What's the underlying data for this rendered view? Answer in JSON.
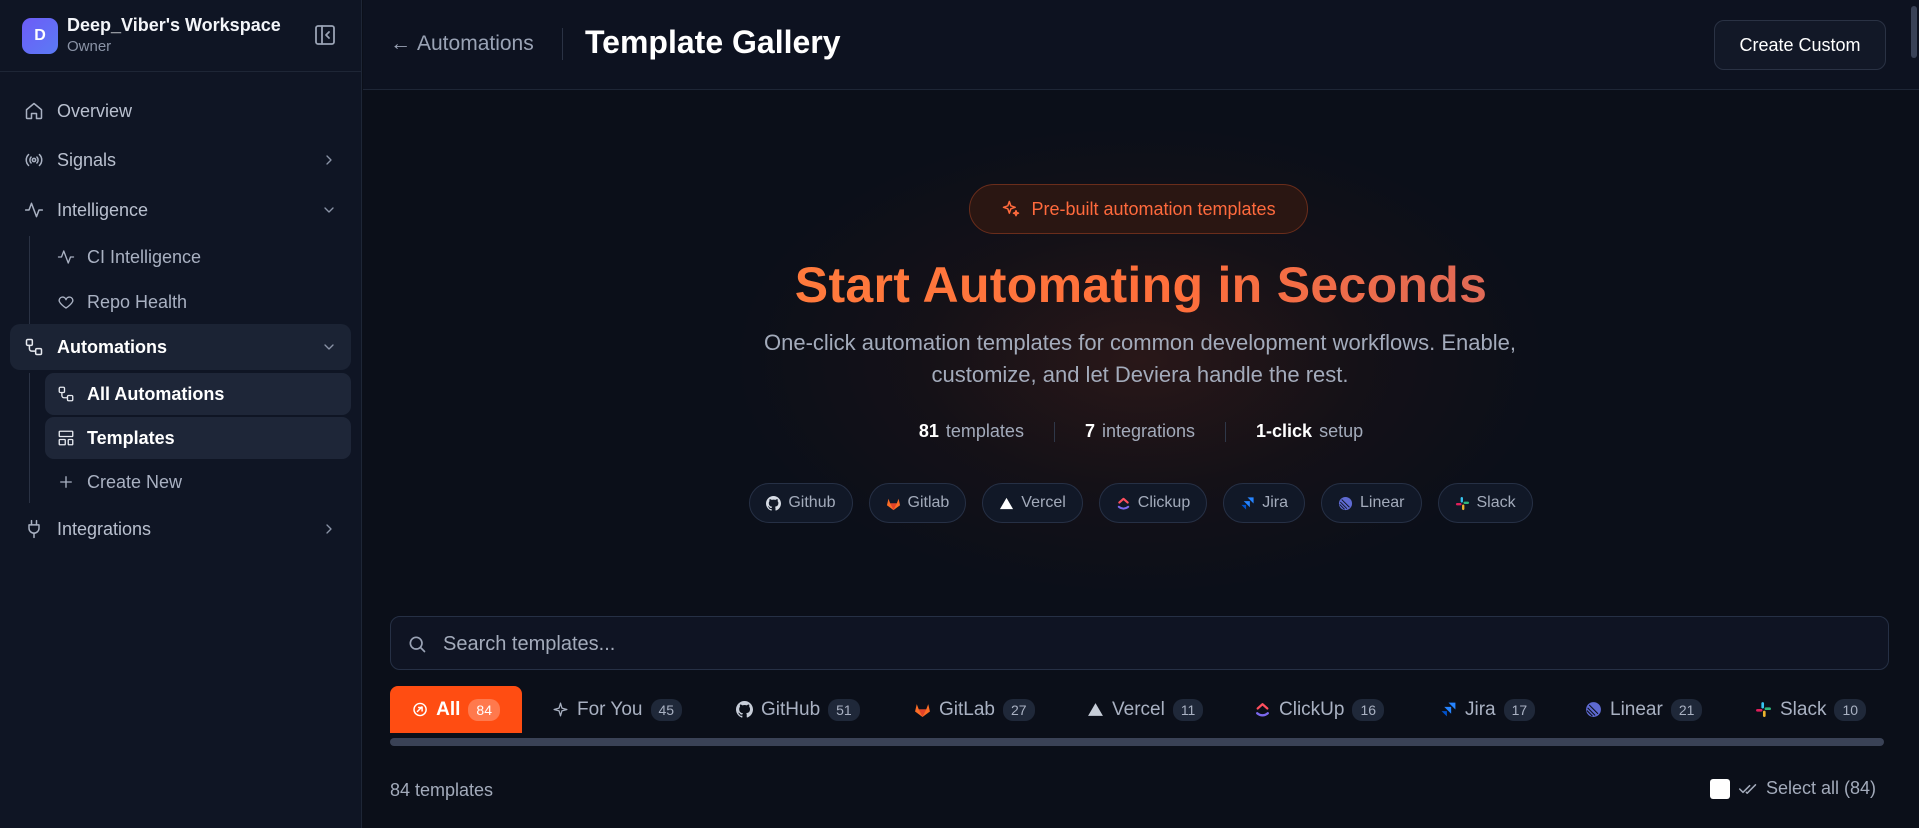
{
  "workspace": {
    "avatar_letter": "D",
    "name": "Deep_Viber's Workspace",
    "role": "Owner"
  },
  "sidebar": {
    "items": [
      {
        "label": "Overview"
      },
      {
        "label": "Signals"
      },
      {
        "label": "Intelligence"
      },
      {
        "label": "Automations"
      },
      {
        "label": "Integrations"
      }
    ],
    "intelligence_sub": [
      {
        "label": "CI Intelligence"
      },
      {
        "label": "Repo Health"
      }
    ],
    "automations_sub": [
      {
        "label": "All Automations"
      },
      {
        "label": "Templates"
      },
      {
        "label": "Create New"
      }
    ]
  },
  "header": {
    "back_label": "Automations",
    "title": "Template Gallery",
    "create_label": "Create Custom"
  },
  "hero": {
    "pill": "Pre-built automation templates",
    "title": "Start Automating in Seconds",
    "subtitle": "One-click automation templates for common development workflows. Enable, customize, and let Deviera handle the rest.",
    "stats": [
      {
        "value": "81",
        "label": "templates"
      },
      {
        "value": "7",
        "label": "integrations"
      },
      {
        "value": "1-click",
        "label": "setup"
      }
    ],
    "integrations": [
      {
        "name": "Github",
        "icon": "github-icon"
      },
      {
        "name": "Gitlab",
        "icon": "gitlab-icon"
      },
      {
        "name": "Vercel",
        "icon": "vercel-icon"
      },
      {
        "name": "Clickup",
        "icon": "clickup-icon"
      },
      {
        "name": "Jira",
        "icon": "jira-icon"
      },
      {
        "name": "Linear",
        "icon": "linear-icon"
      },
      {
        "name": "Slack",
        "icon": "slack-icon"
      }
    ]
  },
  "search": {
    "placeholder": "Search templates..."
  },
  "tabs": [
    {
      "label": "All",
      "count": "84"
    },
    {
      "label": "For You",
      "count": "45"
    },
    {
      "label": "GitHub",
      "count": "51"
    },
    {
      "label": "GitLab",
      "count": "27"
    },
    {
      "label": "Vercel",
      "count": "11"
    },
    {
      "label": "ClickUp",
      "count": "16"
    },
    {
      "label": "Jira",
      "count": "17"
    },
    {
      "label": "Linear",
      "count": "21"
    },
    {
      "label": "Slack",
      "count": "10"
    }
  ],
  "results": {
    "count_text": "84 templates",
    "select_all": "Select all (84)"
  },
  "colors": {
    "accent": "#ff4d12",
    "background": "#0b0f19",
    "sidebar": "#0f1524"
  }
}
